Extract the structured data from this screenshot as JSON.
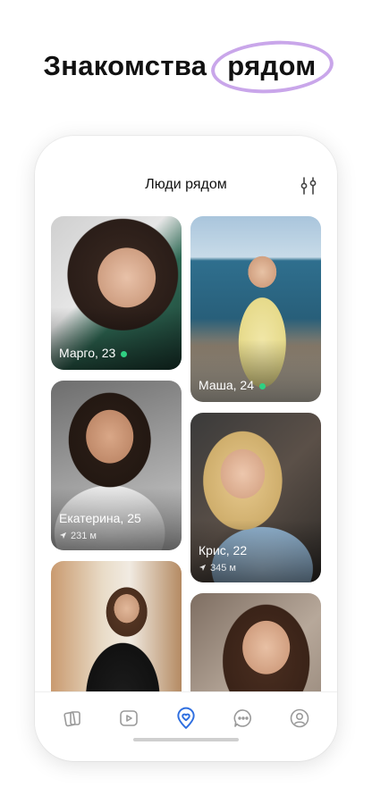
{
  "headline": {
    "part1": "Знакомства",
    "part2": "рядом",
    "ring_color": "#c9a6ea"
  },
  "screen": {
    "title": "Люди рядом"
  },
  "cards": [
    {
      "name": "Марго, 23",
      "online": true
    },
    {
      "name": "Маша, 24",
      "online": true
    },
    {
      "name": "Екатерина, 25",
      "online": false,
      "distance": "231 м"
    },
    {
      "name": "Крис, 22",
      "online": false,
      "distance": "345 м"
    },
    {
      "name": "",
      "online": false
    },
    {
      "name": "",
      "online": false
    }
  ],
  "tabbar": {
    "items": [
      {
        "icon": "cards-icon",
        "active": false
      },
      {
        "icon": "video-icon",
        "active": false
      },
      {
        "icon": "heart-location-icon",
        "active": true
      },
      {
        "icon": "chat-icon",
        "active": false
      },
      {
        "icon": "profile-icon",
        "active": false
      }
    ],
    "active_color": "#2f6fe0",
    "inactive_color": "#9a9a9a"
  },
  "colors": {
    "online": "#2fd082"
  }
}
